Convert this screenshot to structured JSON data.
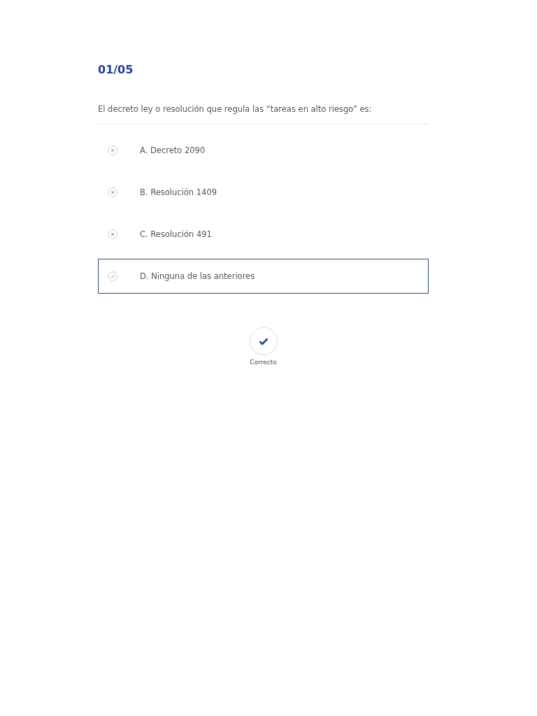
{
  "counter": "01/05",
  "question": "El decreto ley o resolución que regula las “tareas en alto riesgo” es:",
  "options": [
    {
      "label": "A. Decreto 2090",
      "selected": false
    },
    {
      "label": "B. Resolución 1409",
      "selected": false
    },
    {
      "label": "C. Resolución 491",
      "selected": false
    },
    {
      "label": "D. Ninguna de las anteriores",
      "selected": true
    }
  ],
  "result": {
    "label": "Correcto",
    "correct": true
  }
}
